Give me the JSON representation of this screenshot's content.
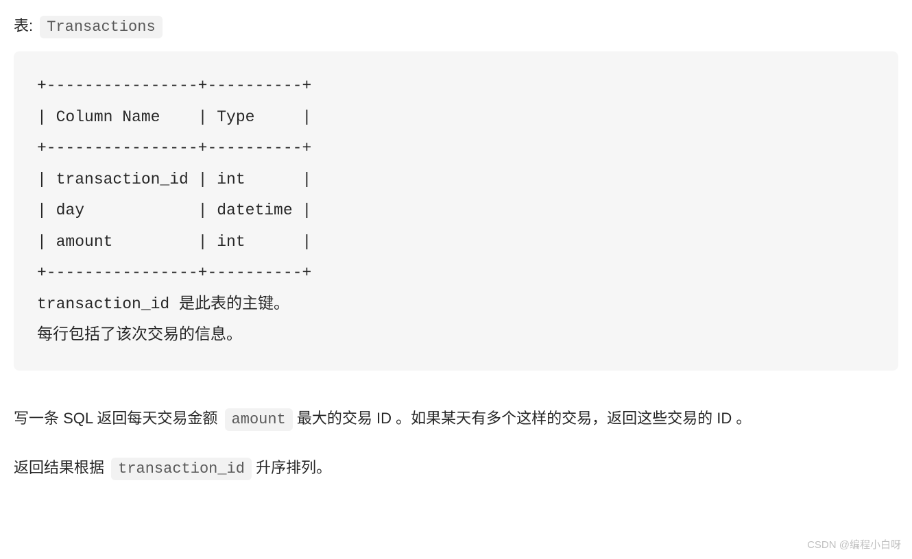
{
  "tableLabel": {
    "prefix": "表: ",
    "tableName": "Transactions"
  },
  "codeBlock": "+----------------+----------+\n| Column Name    | Type     |\n+----------------+----------+\n| transaction_id | int      |\n| day            | datetime |\n| amount         | int      |\n+----------------+----------+\ntransaction_id 是此表的主键。\n每行包括了该次交易的信息。",
  "paragraph1": {
    "part1": "写一条 SQL 返回每天交易金额 ",
    "code": "amount",
    "part2": " 最大的交易 ID 。如果某天有多个这样的交易，返回这些交易的 ID 。"
  },
  "paragraph2": {
    "part1": "返回结果根据 ",
    "code": "transaction_id",
    "part2": " 升序排列。"
  },
  "watermark": "CSDN @编程小白呀"
}
